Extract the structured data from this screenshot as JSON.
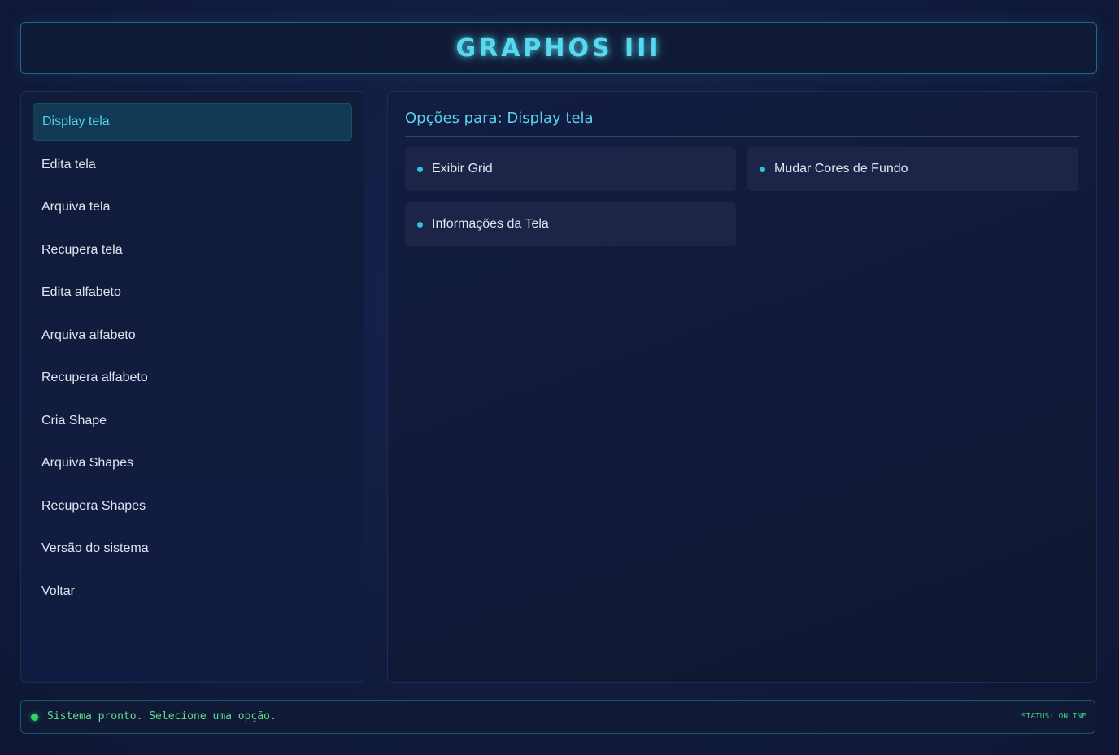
{
  "app": {
    "title": "GRAPHOS III"
  },
  "sidebar": {
    "items": [
      {
        "label": "Display tela",
        "active": true
      },
      {
        "label": "Edita tela"
      },
      {
        "label": "Arquiva tela"
      },
      {
        "label": "Recupera tela"
      },
      {
        "label": "Edita alfabeto"
      },
      {
        "label": "Arquiva alfabeto"
      },
      {
        "label": "Recupera alfabeto"
      },
      {
        "label": "Cria Shape"
      },
      {
        "label": "Arquiva Shapes"
      },
      {
        "label": "Recupera Shapes"
      },
      {
        "label": "Versão do sistema"
      },
      {
        "label": "Voltar"
      }
    ]
  },
  "main": {
    "title": "Opções para: Display tela",
    "options": [
      {
        "label": "Exibir Grid"
      },
      {
        "label": "Mudar Cores de Fundo"
      },
      {
        "label": "Informações da Tela"
      }
    ]
  },
  "status": {
    "message": "Sistema pronto. Selecione uma opção.",
    "state": "STATUS: ONLINE"
  },
  "colors": {
    "accent": "#57d9f0",
    "active_bg": "#123a55",
    "status_green": "#2fd36a",
    "bullet": "#30c0e0"
  }
}
